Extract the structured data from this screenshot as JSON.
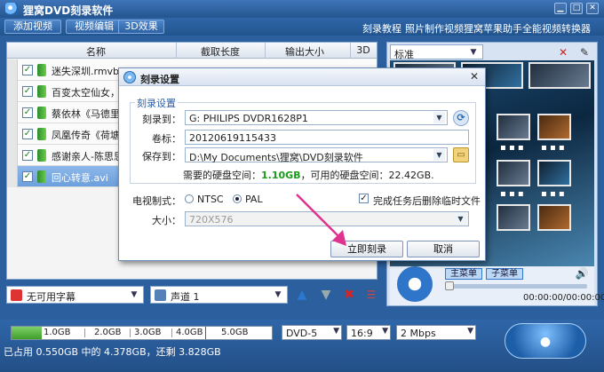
{
  "app": {
    "title": "狸窝DVD刻录软件"
  },
  "toolbar": {
    "buttons": [
      "添加视频",
      "视频编辑",
      "3D效果"
    ],
    "links": [
      "刻录教程",
      "照片制作视频",
      "狸窝苹果助手",
      "全能视频转换器"
    ]
  },
  "filelist": {
    "columns": [
      "名称",
      "截取长度",
      "输出大小",
      "3D"
    ],
    "rows": [
      {
        "name": "迷失深圳.rmvb",
        "checked": true,
        "selected": false
      },
      {
        "name": "百变太空仙女，美",
        "checked": true,
        "selected": false
      },
      {
        "name": "蔡依林《马德里不",
        "checked": true,
        "selected": false
      },
      {
        "name": "凤凰传奇《荷塘月",
        "checked": true,
        "selected": false
      },
      {
        "name": "感谢亲人-陈思思.",
        "checked": true,
        "selected": false
      },
      {
        "name": "回心转意.avi",
        "checked": true,
        "selected": true
      }
    ]
  },
  "listctrl": {
    "subtitle": "无可用字幕",
    "audio": "声道 1"
  },
  "menu_panel": {
    "template": "标准",
    "main_menu": "主菜单",
    "sub_menu": "子菜单",
    "time": "00:00:00/00:00:00"
  },
  "bottom": {
    "capacity_ticks": [
      "1.0GB",
      "2.0GB",
      "3.0GB",
      "4.0GB",
      "5.0GB"
    ],
    "used_fraction": 0.117,
    "disc_type": "DVD-5",
    "aspect": "16:9",
    "bitrate": "2 Mbps",
    "status": "已占用 0.550GB 中的 4.378GB，还剩 3.828GB"
  },
  "dialog": {
    "title": "刻录设置",
    "group_label": "刻录设置",
    "burn_to_label": "刻录到：",
    "burn_to_value": "G: PHILIPS  DVDR1628P1",
    "volume_label": "卷标：",
    "volume_value": "20120619115433",
    "save_label": "保存到：",
    "save_value": "D:\\My Documents\\狸窝\\DVD刻录软件",
    "need_prefix": "需要的硬盘空间：",
    "need_value": "1.10GB",
    "avail_text": "，可用的硬盘空间：22.42GB.",
    "tv_label": "电视制式：",
    "ntsc": "NTSC",
    "pal": "PAL",
    "delete_temp": "完成任务后删除临时文件",
    "size_label": "大小：",
    "size_value": "720X576",
    "burn_now": "立即刻录",
    "cancel": "取消"
  },
  "colors": {
    "accent": "#2b5f9e",
    "selected_row": "#6c9fdc",
    "arrow": "#e0338f"
  }
}
